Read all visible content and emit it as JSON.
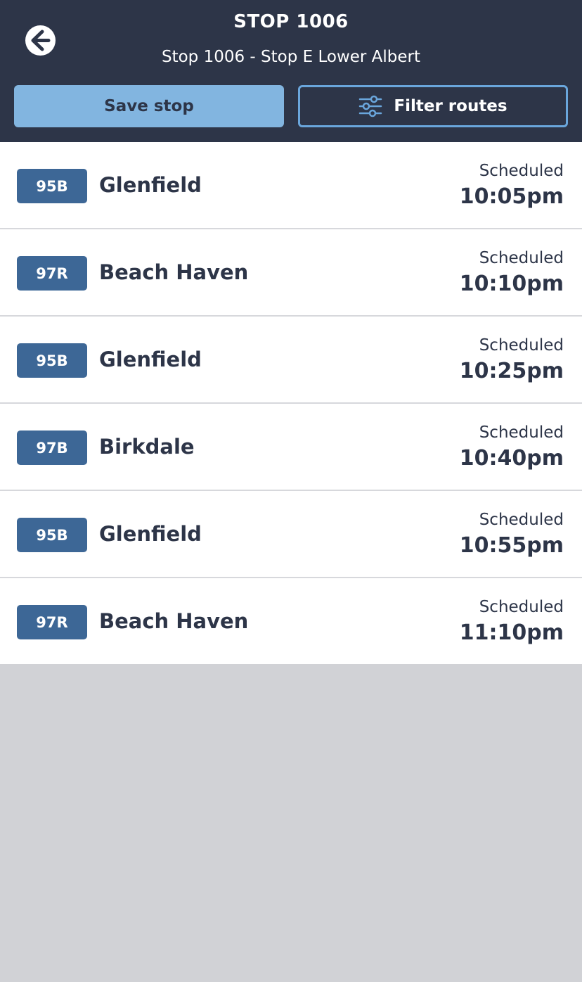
{
  "header": {
    "title": "STOP 1006",
    "subtitle": "Stop 1006 - Stop E Lower Albert",
    "save_label": "Save stop",
    "filter_label": "Filter routes"
  },
  "departures": [
    {
      "route": "95B",
      "destination": "Glenfield",
      "status": "Scheduled",
      "time": "10:05pm"
    },
    {
      "route": "97R",
      "destination": "Beach Haven",
      "status": "Scheduled",
      "time": "10:10pm"
    },
    {
      "route": "95B",
      "destination": "Glenfield",
      "status": "Scheduled",
      "time": "10:25pm"
    },
    {
      "route": "97B",
      "destination": "Birkdale",
      "status": "Scheduled",
      "time": "10:40pm"
    },
    {
      "route": "95B",
      "destination": "Glenfield",
      "status": "Scheduled",
      "time": "10:55pm"
    },
    {
      "route": "97R",
      "destination": "Beach Haven",
      "status": "Scheduled",
      "time": "11:10pm"
    }
  ],
  "colors": {
    "header_bg": "#2d3548",
    "route_badge": "#3d6796",
    "save_button": "#82b5e0",
    "filter_border": "#6aa6dc"
  },
  "icons": {
    "back": "arrow-left-circle-icon",
    "filter": "sliders-icon"
  }
}
